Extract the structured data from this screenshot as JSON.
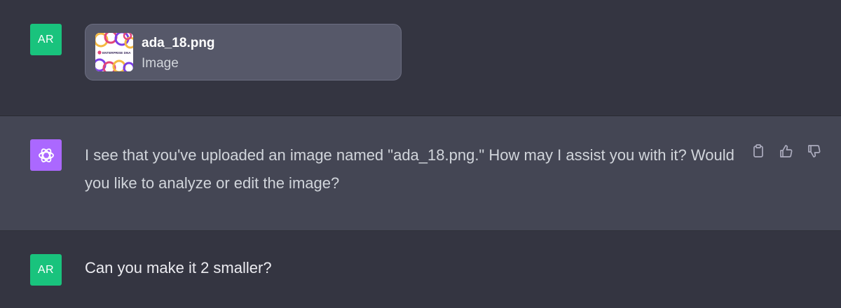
{
  "conversation": {
    "messages": [
      {
        "role": "user",
        "avatar": "AR",
        "attachment": {
          "filename": "ada_18.png",
          "type": "Image",
          "thumbnail_text": "ENTERPRISE DNA"
        }
      },
      {
        "role": "assistant",
        "avatar_icon": "openai-logo-icon",
        "text": "I see that you've uploaded an image named \"ada_18.png.\" How may I assist you with it? Would you like to analyze or edit the image?",
        "actions": [
          "copy-icon",
          "thumbs-up-icon",
          "thumbs-down-icon"
        ]
      },
      {
        "role": "user",
        "avatar": "AR",
        "text": "Can you make it 2 smaller?"
      }
    ]
  },
  "colors": {
    "background": "#343541",
    "assistant_row": "#444654",
    "user_avatar": "#19c37d",
    "assistant_avatar": "#ab68ff",
    "file_card": "#565869"
  }
}
